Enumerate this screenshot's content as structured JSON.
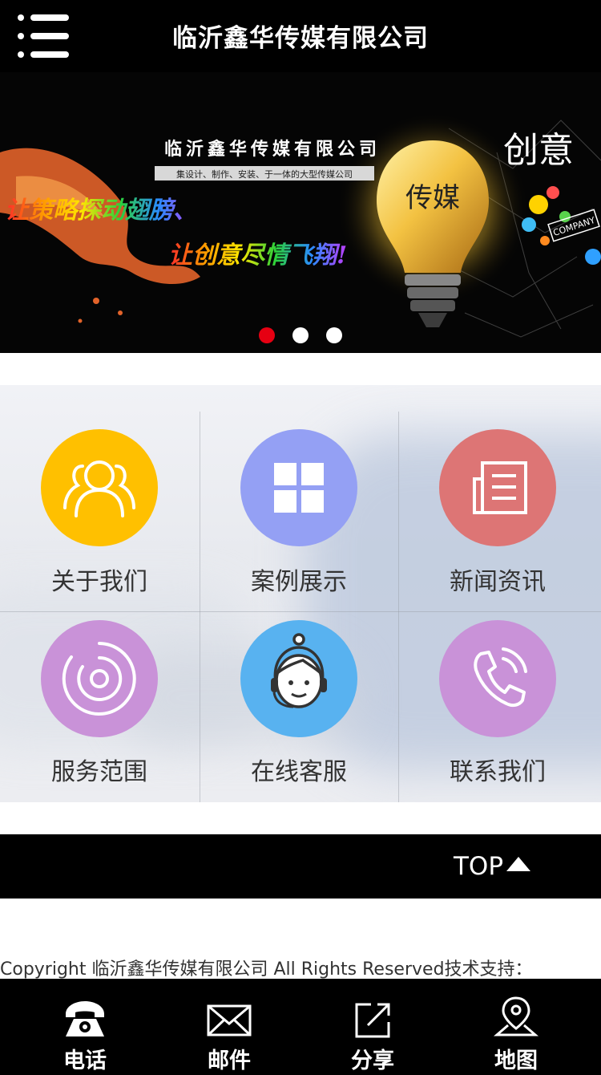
{
  "header": {
    "title": "临沂鑫华传媒有限公司"
  },
  "banner": {
    "company_name": "临沂鑫华传媒有限公司",
    "tagline": "集设计、制作、安装、于一体的大型传媒公司",
    "slogan_line1": "让策略探动翅膀、",
    "slogan_line2": "让创意尽情飞翔!",
    "bulb_text": "传媒",
    "creative_text": "创意",
    "company_tag": "COMPANY",
    "active_slide": 1,
    "slide_count": 3
  },
  "menu": {
    "items": [
      {
        "label": "关于我们",
        "icon": "team-icon",
        "color": "#ffc000"
      },
      {
        "label": "案例展示",
        "icon": "grid-icon",
        "color": "#94a0f4"
      },
      {
        "label": "新闻资讯",
        "icon": "news-icon",
        "color": "#dd7575"
      },
      {
        "label": "服务范围",
        "icon": "target-icon",
        "color": "#c992d8"
      },
      {
        "label": "在线客服",
        "icon": "customer-service-icon",
        "color": "#58b2f0"
      },
      {
        "label": "联系我们",
        "icon": "phone-icon",
        "color": "#c992d8"
      }
    ]
  },
  "top_bar": {
    "label": "TOP"
  },
  "footer": {
    "copyright": "Copyright 临沂鑫华传媒有限公司 All Rights Reserved技术支持："
  },
  "bottom_nav": {
    "items": [
      {
        "label": "电话",
        "icon": "telephone-icon"
      },
      {
        "label": "邮件",
        "icon": "mail-icon"
      },
      {
        "label": "分享",
        "icon": "share-icon"
      },
      {
        "label": "地图",
        "icon": "map-pin-icon"
      }
    ]
  }
}
